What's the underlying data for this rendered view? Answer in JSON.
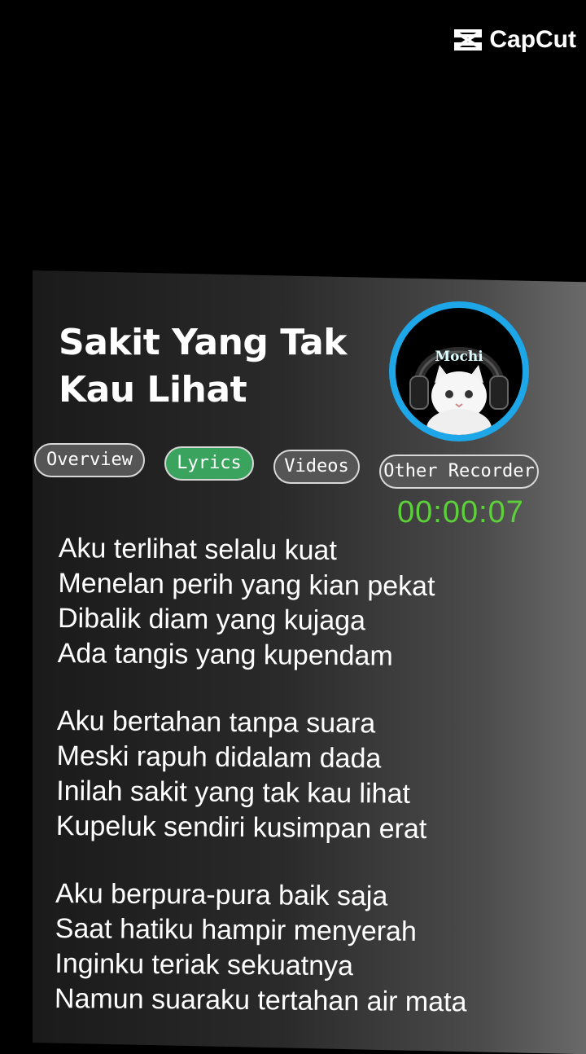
{
  "watermark": {
    "brand": "CapCut"
  },
  "song": {
    "title_line1": "Sakit Yang Tak",
    "title_line2": "Kau Lihat"
  },
  "avatar": {
    "label": "Mochi"
  },
  "tabs": [
    {
      "label": "Overview",
      "active": false
    },
    {
      "label": "Lyrics",
      "active": true
    },
    {
      "label": "Videos",
      "active": false
    },
    {
      "label": "Other Recorder",
      "active": false
    }
  ],
  "timer": "00:00:07",
  "lyrics": {
    "stanzas": [
      [
        "Aku terlihat selalu kuat",
        "Menelan perih yang kian pekat",
        "Dibalik diam yang kujaga",
        "Ada tangis yang kupendam"
      ],
      [
        "Aku bertahan tanpa suara",
        "Meski rapuh didalam dada",
        "Inilah sakit yang tak kau lihat",
        "Kupeluk sendiri kusimpan erat"
      ],
      [
        "Aku berpura-pura baik saja",
        "Saat hatiku hampir menyerah",
        "Inginku teriak sekuatnya",
        "Namun suaraku tertahan air mata"
      ]
    ]
  },
  "colors": {
    "accent_green": "#3aa35d",
    "timer_green": "#5dd13a",
    "ring_blue": "#1ea7e8"
  }
}
